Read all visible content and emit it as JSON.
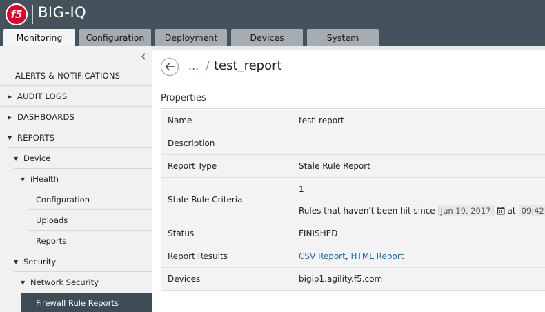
{
  "header": {
    "logo_text": "f5",
    "app_title": "BIG-IQ"
  },
  "tabs": [
    {
      "label": "Monitoring",
      "active": true
    },
    {
      "label": "Configuration",
      "active": false
    },
    {
      "label": "Deployment",
      "active": false
    },
    {
      "label": "Devices",
      "active": false
    },
    {
      "label": "System",
      "active": false
    }
  ],
  "sidebar": {
    "collapse_icon": "chevron-left-icon",
    "items": [
      {
        "label": "ALERTS & NOTIFICATIONS",
        "expander": "none"
      },
      {
        "label": "AUDIT LOGS",
        "expander": "collapsed"
      },
      {
        "label": "DASHBOARDS",
        "expander": "collapsed"
      },
      {
        "label": "REPORTS",
        "expander": "expanded"
      },
      {
        "label": "Device",
        "expander": "expanded"
      },
      {
        "label": "iHealth",
        "expander": "expanded"
      },
      {
        "label": "Configuration",
        "expander": "none"
      },
      {
        "label": "Uploads",
        "expander": "none"
      },
      {
        "label": "Reports",
        "expander": "none"
      },
      {
        "label": "Security",
        "expander": "expanded"
      },
      {
        "label": "Network Security",
        "expander": "expanded"
      },
      {
        "label": "Firewall Rule Reports",
        "expander": "none",
        "selected": true
      }
    ]
  },
  "breadcrumb": {
    "ellipsis": "...",
    "separator": "/",
    "title": "test_report"
  },
  "properties": {
    "heading": "Properties",
    "name_label": "Name",
    "name_value": "test_report",
    "description_label": "Description",
    "description_value": "",
    "report_type_label": "Report Type",
    "report_type_value": "Stale Rule Report",
    "criteria_label": "Stale Rule Criteria",
    "criteria_count": "1",
    "criteria_text": "Rules that haven't been hit since",
    "criteria_date": "Jun 19, 2017",
    "criteria_at": "at",
    "criteria_time": "09:42",
    "status_label": "Status",
    "status_value": "FINISHED",
    "results_label": "Report Results",
    "csv_link": "CSV Report",
    "results_comma": ",",
    "html_link": "HTML Report",
    "devices_label": "Devices",
    "devices_value": "bigip1.agility.f5.com"
  },
  "colors": {
    "header_bg": "#44525c",
    "logo_red": "#e4002b",
    "link_blue": "#1d69b4",
    "selected_nav": "#3e4c56"
  }
}
